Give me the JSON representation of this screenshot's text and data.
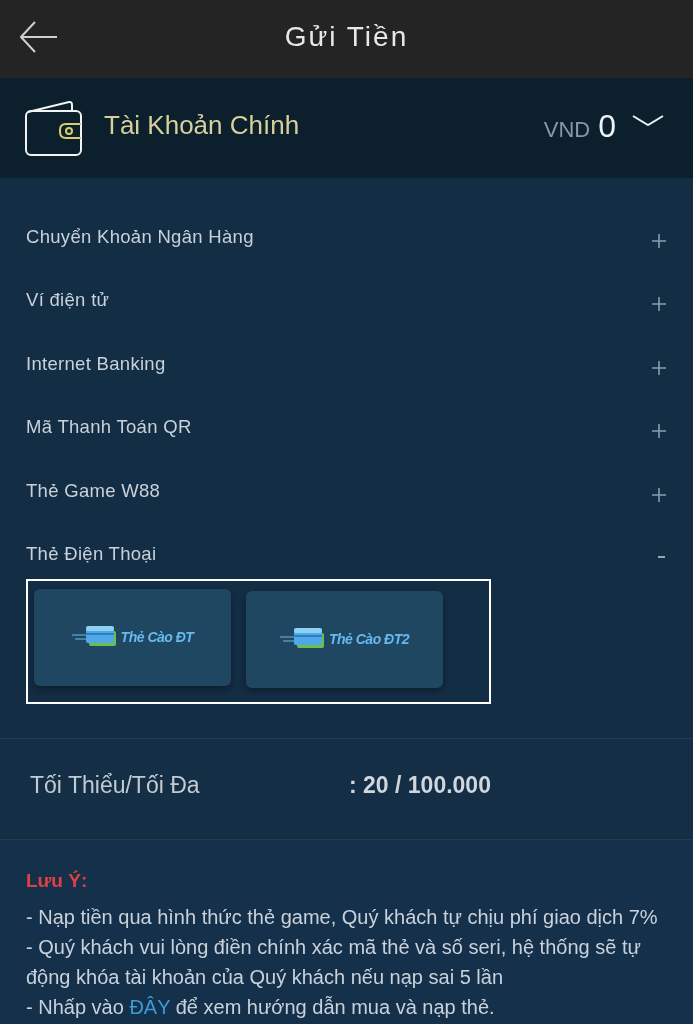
{
  "header": {
    "title": "Gửi Tiền"
  },
  "account": {
    "name": "Tài Khoản Chính",
    "currency": "VND",
    "balance": "0"
  },
  "methods": [
    {
      "label": "Chuyển Khoản Ngân Hàng",
      "expanded": false
    },
    {
      "label": "Ví điện tử",
      "expanded": false
    },
    {
      "label": "Internet Banking",
      "expanded": false
    },
    {
      "label": "Mã Thanh Toán QR",
      "expanded": false
    },
    {
      "label": "Thẻ Game W88",
      "expanded": false
    },
    {
      "label": "Thẻ Điện Thoại",
      "expanded": true,
      "options": [
        {
          "label": "Thẻ Cào ĐT"
        },
        {
          "label": "Thẻ Cào ĐT2"
        }
      ]
    }
  ],
  "limits": {
    "label": "Tối Thiểu/Tối Đa",
    "value": ": 20 / 100.000"
  },
  "notes": {
    "title": "Lưu Ý:",
    "lines": [
      {
        "kind": "text",
        "text": "- Nạp tiền qua hình thức thẻ game, Quý khách tự chịu phí giao dịch 7%"
      },
      {
        "kind": "text",
        "text": "- Quý khách vui lòng điền chính xác mã thẻ và số seri, hệ thống sẽ tự động khóa tài khoản của Quý khách nếu nạp sai 5 lần"
      },
      {
        "kind": "link",
        "before": "- Nhấp vào ",
        "link": "ĐÂY",
        "after": " để xem hướng dẫn mua và nạp thẻ."
      }
    ]
  }
}
